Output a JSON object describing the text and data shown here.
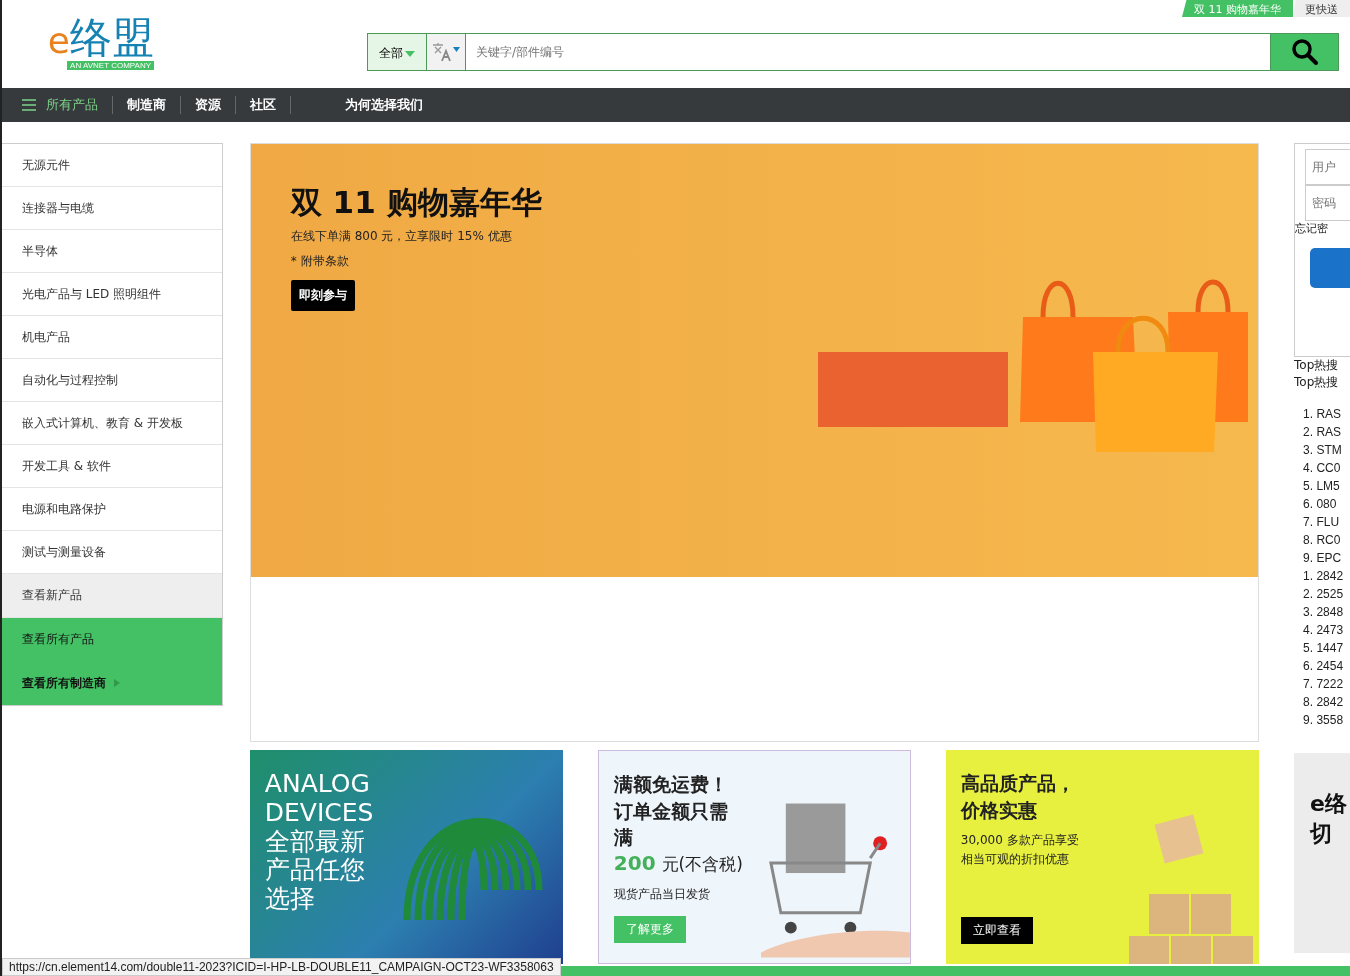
{
  "promo_tabs": [
    {
      "label": "双 11 购物嘉年华",
      "selected": true
    },
    {
      "label": "更快送",
      "selected": false
    }
  ],
  "logo": {
    "text": "络盟",
    "prefix": "e",
    "tagline": "AN AVNET COMPANY"
  },
  "search": {
    "scope": "全部",
    "placeholder": "关键字/部件编号"
  },
  "nav": [
    {
      "label": "所有产品",
      "kind": "menu"
    },
    {
      "label": "制造商",
      "kind": "link"
    },
    {
      "label": "资源",
      "kind": "link"
    },
    {
      "label": "社区",
      "kind": "link"
    },
    {
      "label": "为何选择我们",
      "kind": "wide"
    }
  ],
  "sidebar": [
    {
      "label": "无源元件",
      "kind": "category"
    },
    {
      "label": "连接器与电缆",
      "kind": "category"
    },
    {
      "label": "半导体",
      "kind": "category"
    },
    {
      "label": "光电产品与 LED 照明组件",
      "kind": "category"
    },
    {
      "label": "机电产品",
      "kind": "category"
    },
    {
      "label": "自动化与过程控制",
      "kind": "category"
    },
    {
      "label": "嵌入式计算机、教育 & 开发板",
      "kind": "category"
    },
    {
      "label": "开发工具 & 软件",
      "kind": "category"
    },
    {
      "label": "电源和电路保护",
      "kind": "category"
    },
    {
      "label": "测试与测量设备",
      "kind": "category"
    },
    {
      "label": "查看新产品",
      "kind": "new"
    },
    {
      "label": "查看所有产品",
      "kind": "all"
    },
    {
      "label": "查看所有制造商",
      "kind": "all-arrow"
    }
  ],
  "banner": {
    "title": "双 11 购物嘉年华",
    "subtitle": "在线下单满 800 元，立享限时 15% 优惠",
    "note": "* 附带条款",
    "button": "即刻参与"
  },
  "login": {
    "username_placeholder": "用户",
    "password_placeholder": "密码",
    "forgot": "忘记密"
  },
  "hot": {
    "headings": [
      "Top热搜",
      "Top热搜"
    ],
    "terms": [
      "1. RAS",
      "2. RAS",
      "3. STM",
      "4. CC0",
      "5. LM5",
      "6. 080",
      "7. FLU",
      "8. RC0",
      "9. EPC"
    ],
    "products": [
      "1. 2842",
      "2. 2525",
      "3. 2848",
      "4. 2473",
      "5. 1447",
      "6. 2454",
      "7. 7222",
      "8. 2842",
      "9. 3558"
    ]
  },
  "cards": [
    {
      "kind": "analog",
      "lines": [
        "ANALOG",
        "DEVICES",
        "全部最新",
        "产品任您",
        "选择"
      ]
    },
    {
      "kind": "shipping",
      "lines": [
        "满额免运费！",
        "订单金额只需满"
      ],
      "amount": "200",
      "amount_suffix": "元(不含税)",
      "sub": "现货产品当日发货",
      "button": "了解更多"
    },
    {
      "kind": "discount",
      "lines": [
        "高品质产品，",
        "价格实惠"
      ],
      "sub": [
        "30,000 多款产品享受",
        "相当可观的折扣优惠"
      ],
      "button": "立即查看"
    }
  ],
  "side_card": {
    "lines": [
      "e络",
      "切"
    ]
  },
  "status_bar": {
    "url": "https://cn.element14.com/double11-2023?ICID=I-HP-LB-DOUBLE11_CAMPAIGN-OCT23-WF3358063"
  }
}
